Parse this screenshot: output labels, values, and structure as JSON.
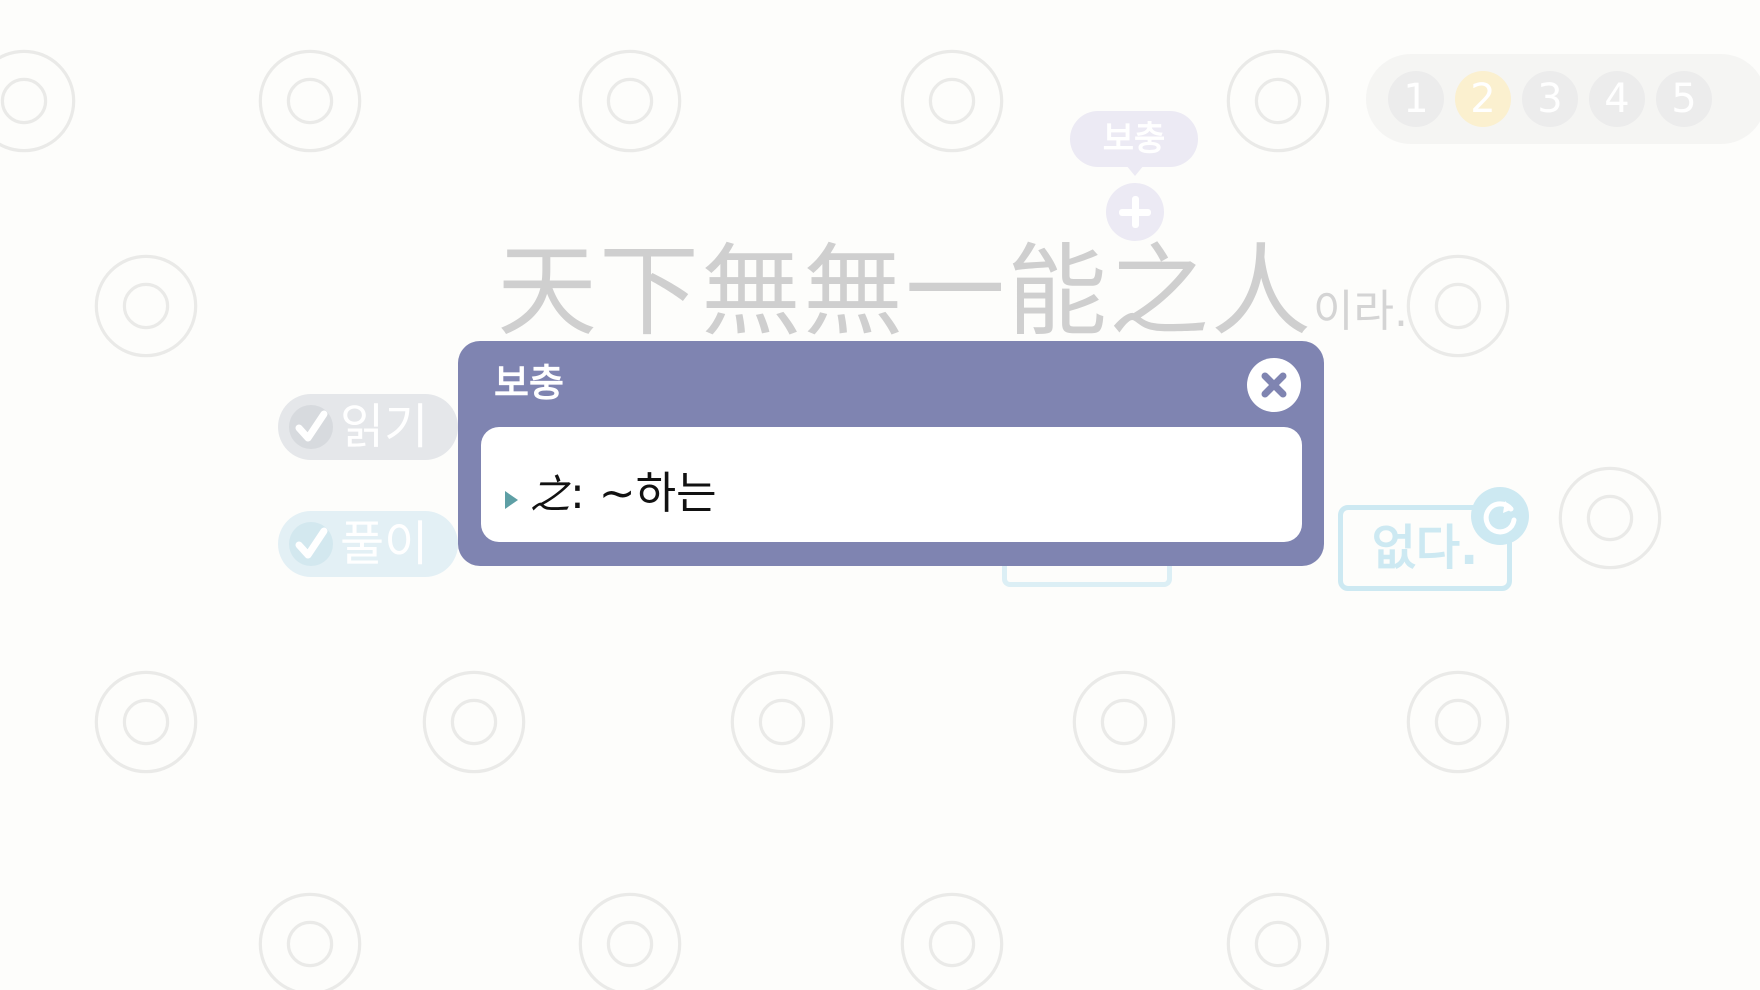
{
  "pager": {
    "pages": [
      "1",
      "2",
      "3",
      "4",
      "5"
    ],
    "active_page": "2"
  },
  "supplement": {
    "tooltip_label": "보충"
  },
  "sentence": {
    "hanja": "天下無無一能之人",
    "suffix": "이라."
  },
  "side_buttons": {
    "read_label": "읽기",
    "interpret_label": "풀이"
  },
  "answer": {
    "text": "없다."
  },
  "popup": {
    "title": "보충",
    "entry_char": "之",
    "entry_gloss": ": ~하는"
  },
  "colors": {
    "popup_bg": "#7f84b1",
    "active_page": "#fbf0cf",
    "interpret_accent": "#cde9f2",
    "arrow": "#5e9fa5"
  }
}
